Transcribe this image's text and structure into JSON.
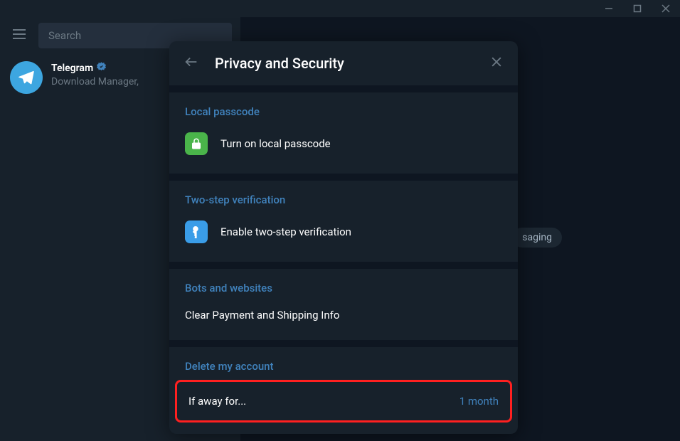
{
  "titlebar": {},
  "sidebar": {
    "search_placeholder": "Search",
    "chat": {
      "name": "Telegram",
      "preview": "Download Manager,"
    }
  },
  "background": {
    "badge_text": "saging"
  },
  "modal": {
    "title": "Privacy and Security",
    "sections": {
      "local_passcode": {
        "title": "Local passcode",
        "action": "Turn on local passcode"
      },
      "two_step": {
        "title": "Two-step verification",
        "action": "Enable two-step verification"
      },
      "bots": {
        "title": "Bots and websites",
        "action": "Clear Payment and Shipping Info"
      },
      "delete_account": {
        "title": "Delete my account",
        "if_away_label": "If away for...",
        "if_away_value": "1 month"
      }
    }
  }
}
